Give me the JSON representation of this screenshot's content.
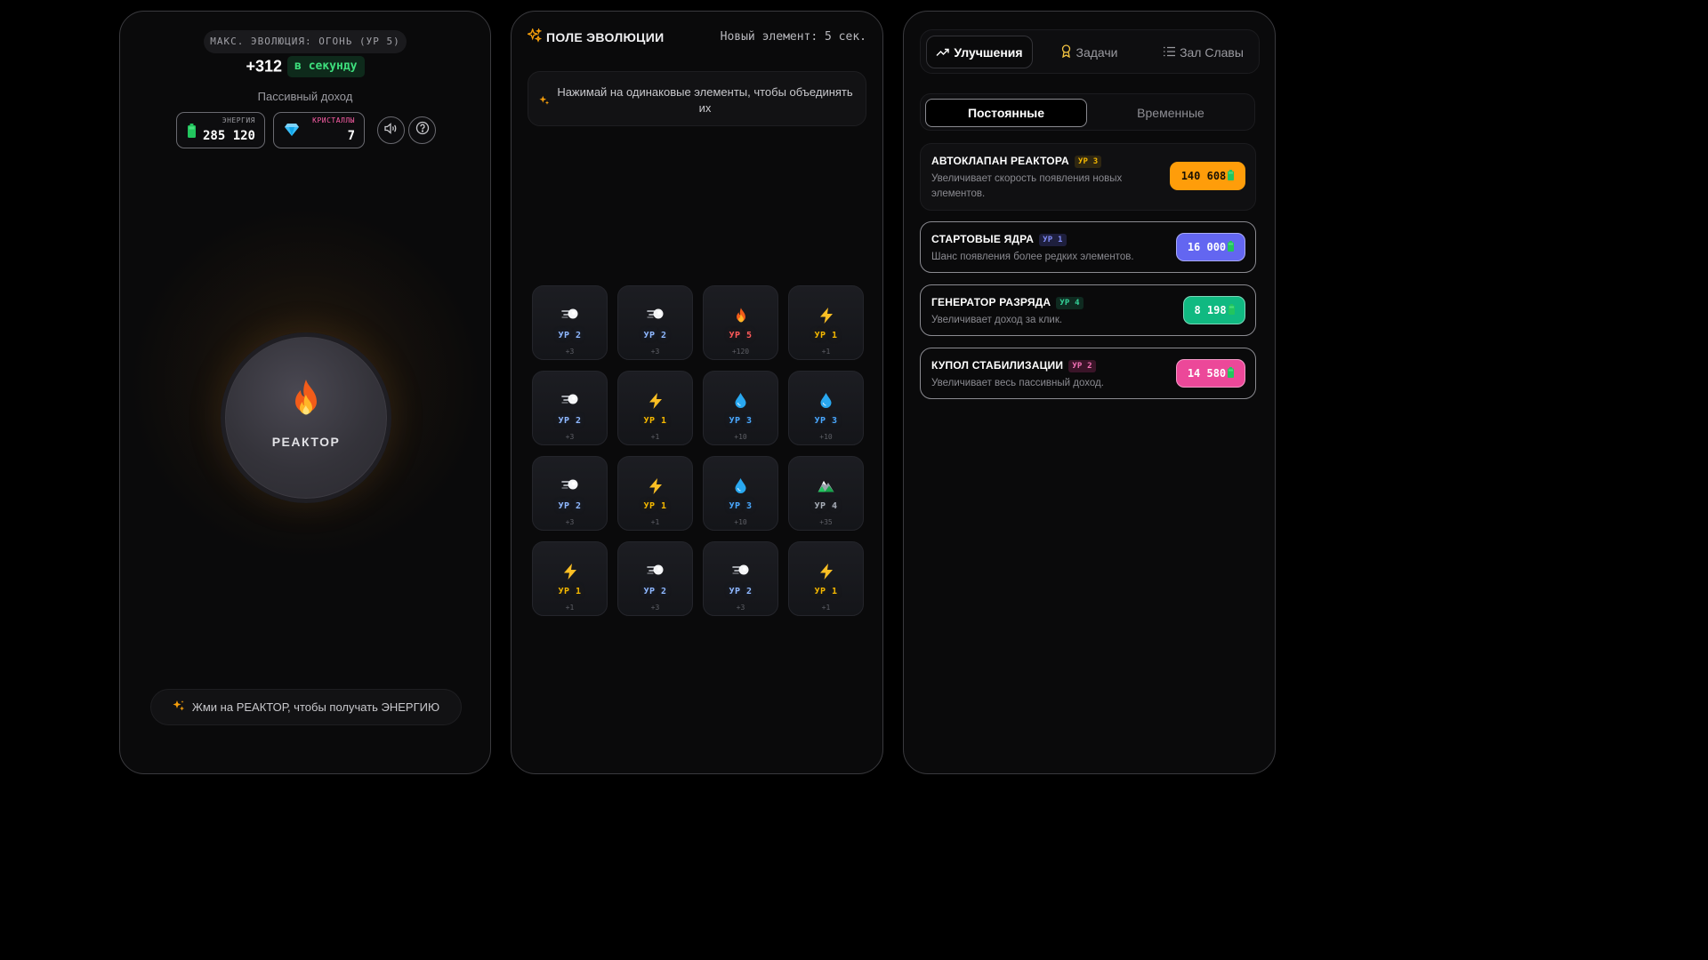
{
  "left": {
    "max_evolution": "МАКС. ЭВОЛЮЦИЯ: ОГОНЬ (УР 5)",
    "rate_value": "+312",
    "rate_unit": "в секунду",
    "passive_label": "Пассивный доход",
    "energy": {
      "label": "ЭНЕРГИЯ",
      "value": "285 120",
      "icon": "battery-icon"
    },
    "crystals": {
      "label": "КРИСТАЛЛЫ",
      "value": "7",
      "icon": "diamond-icon"
    },
    "reactor_label": "РЕАКТОР",
    "hint": "Жми на РЕАКТОР, чтобы получать ЭНЕРГИЮ"
  },
  "field": {
    "title": "ПОЛЕ ЭВОЛЮЦИИ",
    "timer": "Новый элемент: 5 сек.",
    "hint": "Нажимай на одинаковые элементы, чтобы объединять их",
    "cells": [
      {
        "type": "wind",
        "level": "УР 2",
        "gain": "+3"
      },
      {
        "type": "wind",
        "level": "УР 2",
        "gain": "+3"
      },
      {
        "type": "fire",
        "level": "УР 5",
        "gain": "+120"
      },
      {
        "type": "lightning",
        "level": "УР 1",
        "gain": "+1"
      },
      {
        "type": "wind",
        "level": "УР 2",
        "gain": "+3"
      },
      {
        "type": "lightning",
        "level": "УР 1",
        "gain": "+1"
      },
      {
        "type": "water",
        "level": "УР 3",
        "gain": "+10"
      },
      {
        "type": "water",
        "level": "УР 3",
        "gain": "+10"
      },
      {
        "type": "wind",
        "level": "УР 2",
        "gain": "+3"
      },
      {
        "type": "lightning",
        "level": "УР 1",
        "gain": "+1"
      },
      {
        "type": "water",
        "level": "УР 3",
        "gain": "+10"
      },
      {
        "type": "earth",
        "level": "УР 4",
        "gain": "+35"
      },
      {
        "type": "lightning",
        "level": "УР 1",
        "gain": "+1"
      },
      {
        "type": "wind",
        "level": "УР 2",
        "gain": "+3"
      },
      {
        "type": "wind",
        "level": "УР 2",
        "gain": "+3"
      },
      {
        "type": "lightning",
        "level": "УР 1",
        "gain": "+1"
      }
    ]
  },
  "right": {
    "tabs": [
      {
        "label": "Улучшения",
        "icon": "trending-up-icon"
      },
      {
        "label": "Задачи",
        "icon": "award-icon"
      },
      {
        "label": "Зал Славы",
        "icon": "list-icon"
      }
    ],
    "subtabs": [
      {
        "label": "Постоянные"
      },
      {
        "label": "Временные"
      }
    ],
    "upgrades": [
      {
        "name": "АВТОКЛАПАН РЕАКТОРА",
        "level": "УР 3",
        "desc": "Увеличивает скорость появления новых элементов.",
        "price": "140 608",
        "color": "#ff9d0a"
      },
      {
        "name": "СТАРТОВЫЕ ЯДРА",
        "level": "УР 1",
        "desc": "Шанс появления более редких элементов.",
        "price": "16 000",
        "color": "#6366f1"
      },
      {
        "name": "ГЕНЕРАТОР РАЗРЯДА",
        "level": "УР 4",
        "desc": "Увеличивает доход за клик.",
        "price": "8 198",
        "color": "#10b981"
      },
      {
        "name": "КУПОЛ СТАБИЛИЗАЦИИ",
        "level": "УР 2",
        "desc": "Увеличивает весь пассивный доход.",
        "price": "14 580",
        "color": "#ec4899"
      }
    ]
  }
}
